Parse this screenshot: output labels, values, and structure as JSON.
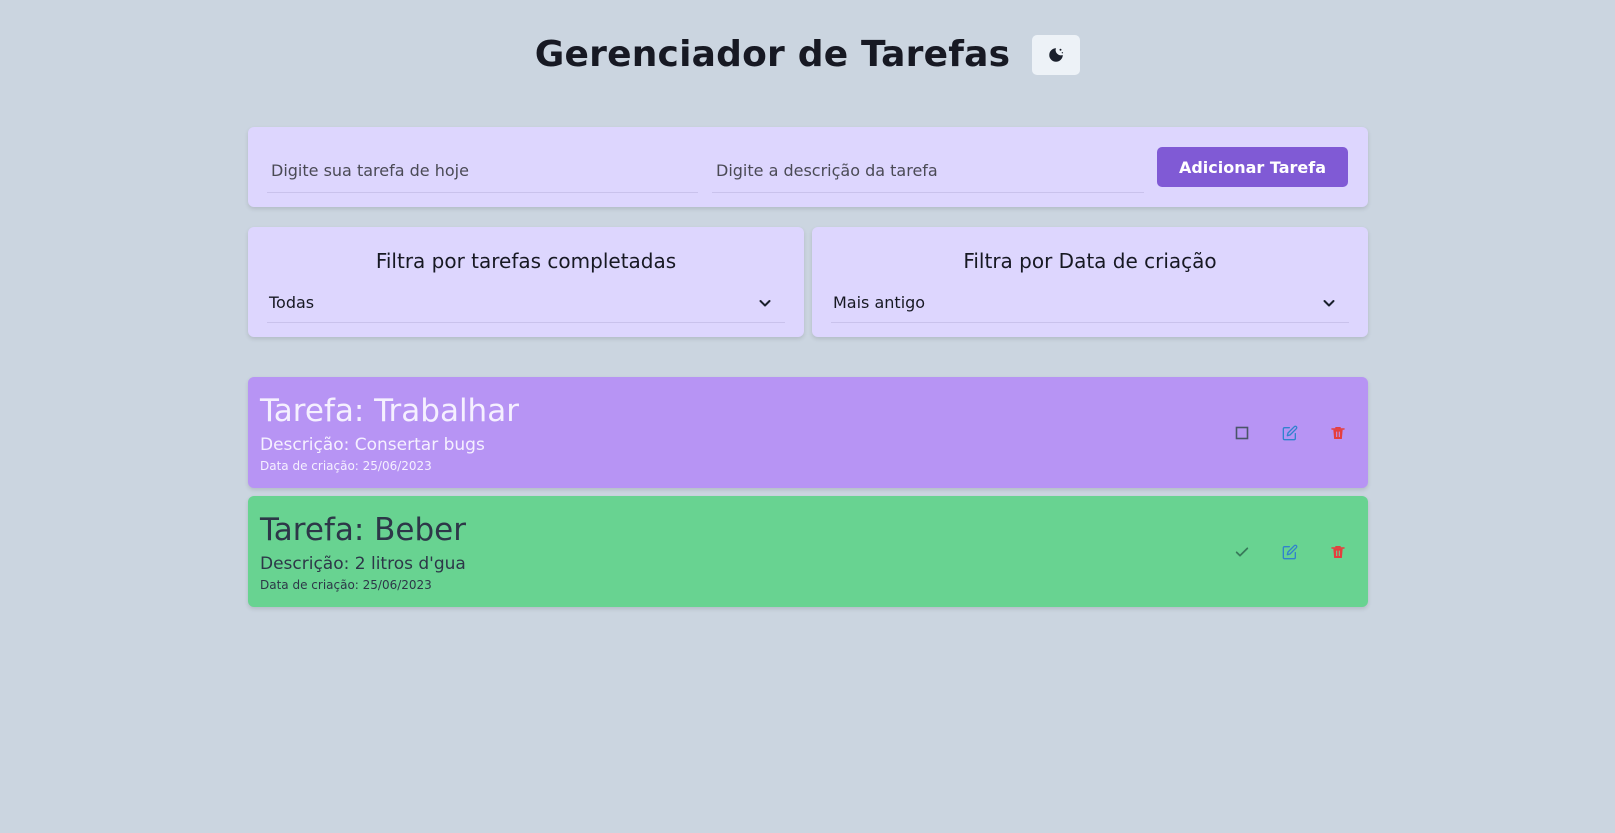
{
  "header": {
    "title": "Gerenciador de Tarefas",
    "theme_icon": "moon-icon"
  },
  "add_form": {
    "task_placeholder": "Digite sua tarefa de hoje",
    "description_placeholder": "Digite a descrição da tarefa",
    "add_button_label": "Adicionar Tarefa"
  },
  "filters": {
    "completed": {
      "title": "Filtra por tarefas completadas",
      "selected": "Todas"
    },
    "created": {
      "title": "Filtra por Data de criação",
      "selected": "Mais antigo"
    }
  },
  "tasks": [
    {
      "title": "Tarefa: Trabalhar",
      "description": "Descrição: Consertar bugs",
      "date": "Data de criação: 25/06/2023",
      "completed": false,
      "color": "#b794f4"
    },
    {
      "title": "Tarefa: Beber",
      "description": "Descrição: 2 litros d'gua",
      "date": "Data de criação: 25/06/2023",
      "completed": true,
      "color": "#68d391"
    }
  ],
  "colors": {
    "background": "#cbd5e0",
    "panel": "#ddd6fe",
    "accent": "#805ad5",
    "edit": "#3182ce",
    "delete": "#e53e3e",
    "check": "#38a169"
  }
}
